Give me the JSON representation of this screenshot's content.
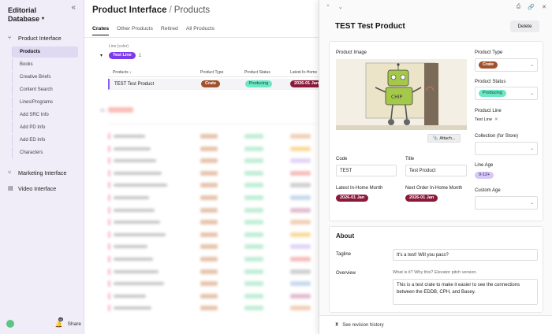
{
  "sidebar": {
    "title": "Editorial",
    "subtitle": "Database",
    "sections": [
      {
        "label": "Product Interface"
      },
      {
        "label": "Marketing Interface"
      },
      {
        "label": "Video Interface"
      }
    ],
    "items": [
      {
        "label": "Products"
      },
      {
        "label": "Books"
      },
      {
        "label": "Creative Briefs"
      },
      {
        "label": "Content Search"
      },
      {
        "label": "Lines/Programs"
      },
      {
        "label": "Add SRC Info"
      },
      {
        "label": "Add PD Info"
      },
      {
        "label": "Add ED Info"
      },
      {
        "label": "Characters"
      }
    ],
    "notif_count": "40",
    "share_label": "Share"
  },
  "main": {
    "breadcrumb_root": "Product Interface",
    "breadcrumb_sep": "/",
    "breadcrumb_current": "Products",
    "tabs": [
      "Crates",
      "Other Products",
      "Retired",
      "All Products"
    ],
    "group_label": "Line (color)",
    "group_name": "Test Line",
    "group_count": "1",
    "columns": [
      "Products",
      "Product Type",
      "Product Status",
      "Latest In-Home"
    ],
    "row": {
      "name": "TEST Test Product",
      "type": "Crate",
      "status": "Producing",
      "date": "2026-01 Jan"
    }
  },
  "panel": {
    "title": "TEST Test Product",
    "delete_label": "Delete",
    "image_label": "Product Image",
    "attach_label": "Attach...",
    "code_label": "Code",
    "code_value": "TEST",
    "title_label": "Title",
    "title_value": "Test Product",
    "latest_label": "Latest In-Home Month",
    "latest_value": "2026-01 Jan",
    "next_label": "Next Order In-Home Month",
    "next_value": "2026-01 Jan",
    "type_label": "Product Type",
    "type_value": "Crate",
    "status_label": "Product Status",
    "status_value": "Producing",
    "line_label": "Product Line",
    "line_value": "Test Line",
    "collection_label": "Collection (for Store)",
    "age_label": "Line Age",
    "age_value": "9-12+",
    "custom_age_label": "Custom Age",
    "about_title": "About",
    "tagline_label": "Tagline",
    "tagline_value": "It's a test! Will you pass?",
    "overview_label": "Overview",
    "overview_hint": "What is it? Why this? Elevator pitch version.",
    "overview_value": "This is a test crate to make it easier to see the connections between the EDDB, CPH, and Basey.",
    "footer_label": "See revision history"
  },
  "colors": {
    "crate": "#a0522d",
    "producing": "#6ee7c4",
    "date": "#8b1a3a",
    "line": "#7c3aed",
    "age": "#d8c8f5"
  }
}
